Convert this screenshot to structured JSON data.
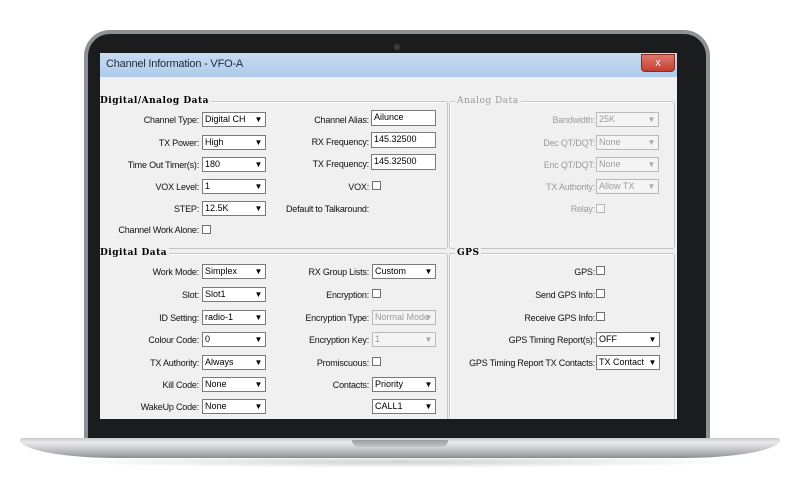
{
  "window": {
    "title": "Channel Information - VFO-A",
    "close_label": "x"
  },
  "groups": {
    "digital_analog": "Digital/Analog Data",
    "analog": "Analog Data",
    "digital": "Digital Data",
    "gps": "GPS"
  },
  "digital_analog": {
    "channel_type": {
      "label": "Channel Type:",
      "value": "Digital CH"
    },
    "tx_power": {
      "label": "TX Power:",
      "value": "High"
    },
    "time_out_timer": {
      "label": "Time Out Timer(s):",
      "value": "180"
    },
    "vox_level": {
      "label": "VOX Level:",
      "value": "1"
    },
    "step": {
      "label": "STEP:",
      "value": "12.5K"
    },
    "channel_work_alone": {
      "label": "Channel Work Alone:"
    },
    "channel_alias": {
      "label": "Channel Alias:",
      "value": "Ailunce"
    },
    "rx_frequency": {
      "label": "RX Frequency:",
      "value": "145.32500"
    },
    "tx_frequency": {
      "label": "TX Frequency:",
      "value": "145.32500"
    },
    "vox": {
      "label": "VOX:"
    },
    "default_talkaround": {
      "label": "Default to Talkaround:"
    }
  },
  "analog": {
    "bandwidth": {
      "label": "Bandwidth:",
      "value": "25K"
    },
    "dec_qt": {
      "label": "Dec QT/DQT:",
      "value": "None"
    },
    "enc_qt": {
      "label": "Enc QT/DQT:",
      "value": "None"
    },
    "tx_authority": {
      "label": "TX Authority:",
      "value": "Allow TX"
    },
    "relay": {
      "label": "Relay:"
    }
  },
  "digital": {
    "work_mode": {
      "label": "Work Mode:",
      "value": "Simplex"
    },
    "slot": {
      "label": "Slot:",
      "value": "Slot1"
    },
    "id_setting": {
      "label": "ID Setting:",
      "value": "radio-1"
    },
    "colour_code": {
      "label": "Colour Code:",
      "value": "0"
    },
    "tx_authority": {
      "label": "TX Authority:",
      "value": "Always"
    },
    "kill_code": {
      "label": "Kill Code:",
      "value": "None"
    },
    "wakeup_code": {
      "label": "WakeUp Code:",
      "value": "None"
    },
    "rx_group_lists": {
      "label": "RX Group Lists:",
      "value": "Custom"
    },
    "encryption": {
      "label": "Encryption:"
    },
    "encryption_type": {
      "label": "Encryption Type:",
      "value": "Normal Mode"
    },
    "encryption_key": {
      "label": "Encryption Key:",
      "value": "1"
    },
    "promiscuous": {
      "label": "Promiscuous:"
    },
    "contacts": {
      "label": "Contacts:",
      "value": "Priority"
    },
    "contact_call": {
      "value": "CALL1"
    }
  },
  "gps": {
    "gps": {
      "label": "GPS:"
    },
    "send_gps_info": {
      "label": "Send GPS Info:"
    },
    "receive_gps_info": {
      "label": "Receive GPS Info:"
    },
    "gps_timing_report": {
      "label": "GPS Timing Report(s):",
      "value": "OFF"
    },
    "gps_timing_report_tx_contacts": {
      "label": "GPS Timing Report TX Contacts:",
      "value": "TX Contact"
    }
  },
  "icons": {
    "dropdown": "chevron-down-icon",
    "close": "close-icon"
  },
  "colors": {
    "titlebar": "#aecbea",
    "close_button": "#c33f30",
    "dialog_bg": "#f0f0f0"
  }
}
